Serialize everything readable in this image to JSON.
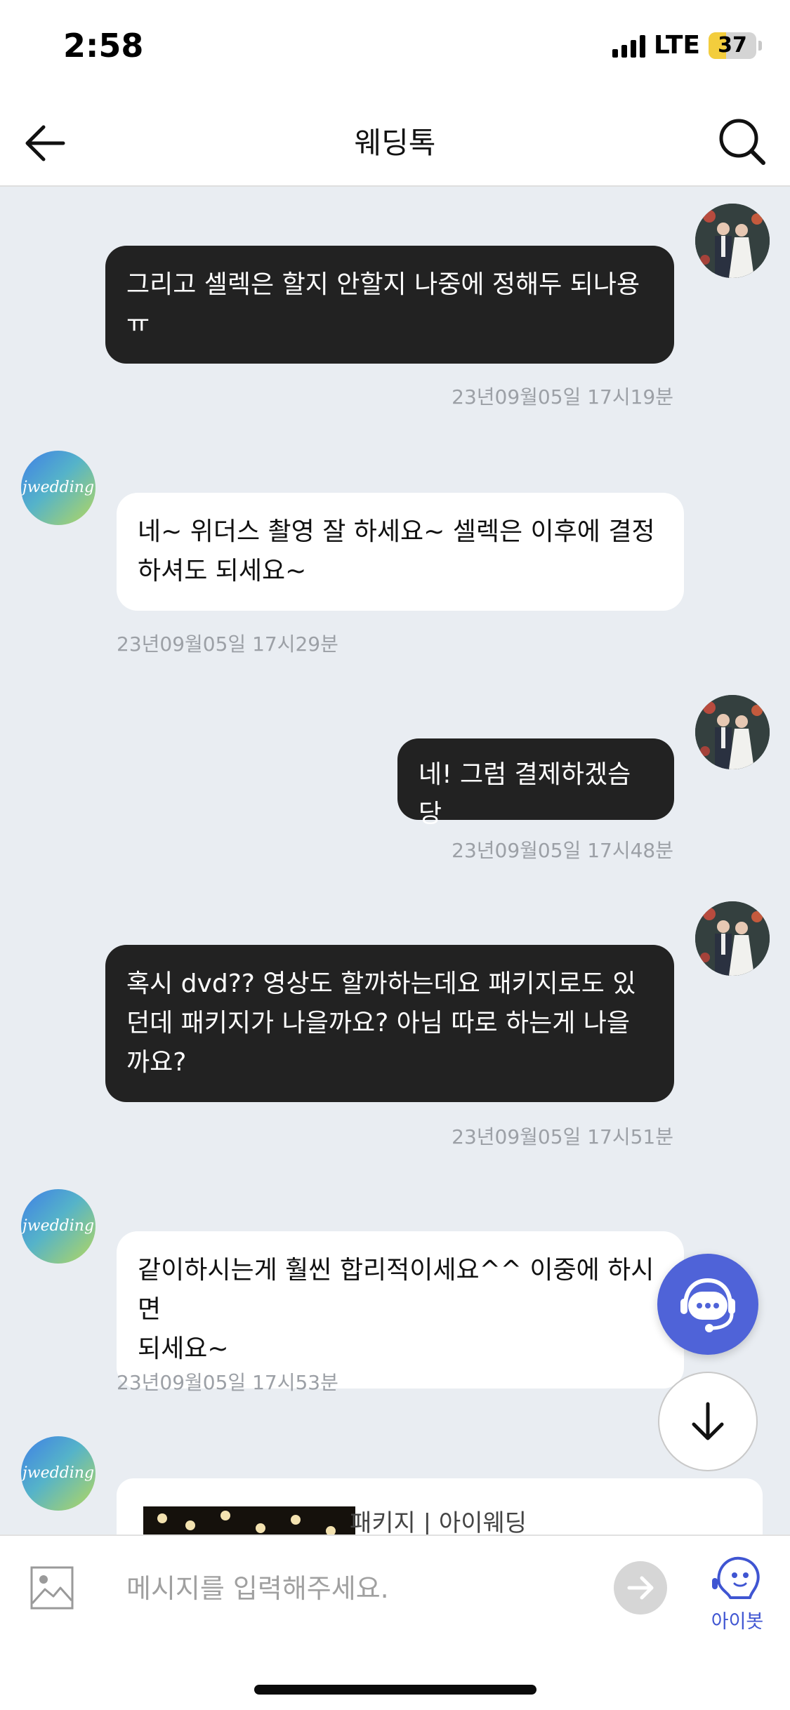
{
  "status_bar": {
    "time": "2:58",
    "network": "LTE",
    "battery": "37",
    "battery_level": 0.37
  },
  "header": {
    "title": "웨딩톡"
  },
  "messages": [
    {
      "sender": "me",
      "text": "그리고 셀렉은 할지 안할지 나중에 정해두 되나용\nㅠ",
      "time": "23년09월05일 17시19분"
    },
    {
      "sender": "bot",
      "avatar_text": "jwedding",
      "text": "네~ 위더스 촬영 잘 하세요~ 셀렉은 이후에 결정\n하셔도 되세요~",
      "time": "23년09월05일 17시29분"
    },
    {
      "sender": "me",
      "text": "네! 그럼 결제하겠슴당",
      "time": "23년09월05일 17시48분"
    },
    {
      "sender": "me",
      "text": "혹시 dvd?? 영상도 할까하는데요 패키지로도 있\n던데 패키지가 나을까요? 아님 따로 하는게 나을\n까요?",
      "time": "23년09월05일 17시51분"
    },
    {
      "sender": "bot",
      "avatar_text": "jwedding",
      "text": "같이하시는게 훨씬 합리적이세요^^ 이중에 하시면\n되세요~",
      "time": "23년09월05일 17시53분"
    }
  ],
  "link_card": {
    "title": "패키지 | 아이웨딩"
  },
  "composer": {
    "placeholder": "메시지를 입력해주세요.",
    "aibot_label": "아이봇"
  },
  "colors": {
    "background": "#e9edf2",
    "my_bubble": "#222222",
    "bot_bubble": "#ffffff",
    "accent": "#4f63d8",
    "timestamp": "#9ca0a6"
  },
  "icons": {
    "back": "arrow-left-icon",
    "search": "search-icon",
    "image": "image-icon",
    "send": "send-arrow-icon",
    "chat": "headset-chat-icon",
    "scroll_down": "arrow-down-icon",
    "aibot": "robot-head-icon"
  }
}
